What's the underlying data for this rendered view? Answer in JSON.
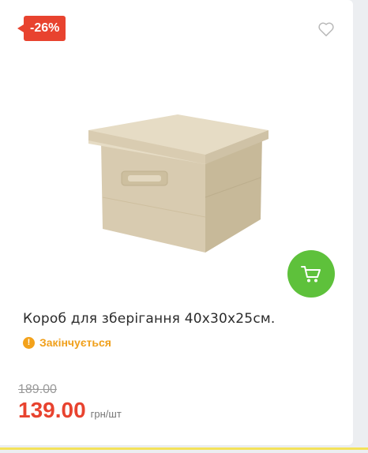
{
  "badge": {
    "discount": "-26%"
  },
  "product": {
    "title": "Короб для зберігання 40x30x25см.",
    "status": "Закінчується",
    "old_price": "189.00",
    "price": "139.00",
    "unit": "грн/шт"
  },
  "icons": {
    "wishlist": "heart-icon",
    "cart": "cart-icon",
    "status": "warning-icon"
  },
  "colors": {
    "badge": "#e8432f",
    "cart_button": "#5ec13b",
    "status": "#f0a01c",
    "price": "#e8432f"
  }
}
